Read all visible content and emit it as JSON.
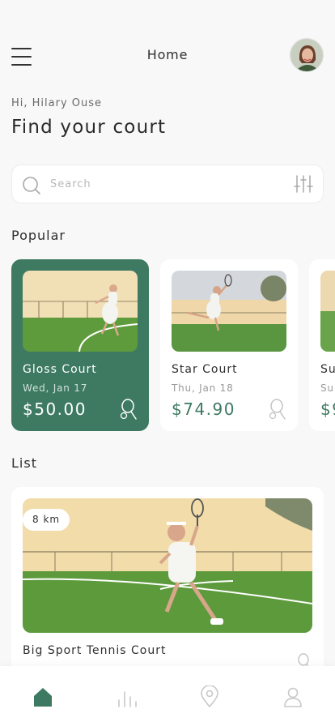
{
  "header": {
    "title": "Home",
    "menu_icon": "hamburger-menu-icon",
    "avatar": "user-avatar"
  },
  "greeting": "Hi, Hilary Ouse",
  "headline": "Find your court",
  "search": {
    "placeholder": "Search",
    "icon": "search-icon",
    "filter_icon": "filter-sliders-icon"
  },
  "popular": {
    "title": "Popular",
    "cards": [
      {
        "name": "Gloss Court",
        "date": "Wed, Jan 17",
        "price": "$50.00",
        "active": true
      },
      {
        "name": "Star Court",
        "date": "Thu, Jan 18",
        "price": "$74.90",
        "active": false
      },
      {
        "name": "Su",
        "date": "Su",
        "price": "$9",
        "active": false
      }
    ]
  },
  "list": {
    "title": "List",
    "items": [
      {
        "name": "Big Sport Tennis Court",
        "distance": "8 km"
      }
    ]
  },
  "tabbar": {
    "items": [
      "home-icon",
      "stats-icon",
      "location-pin-icon",
      "profile-icon"
    ],
    "active": "home-icon"
  },
  "colors": {
    "accent": "#3e7a62",
    "background": "#f8f8f8",
    "card": "#ffffff",
    "muted_text": "#9a9a9a"
  }
}
